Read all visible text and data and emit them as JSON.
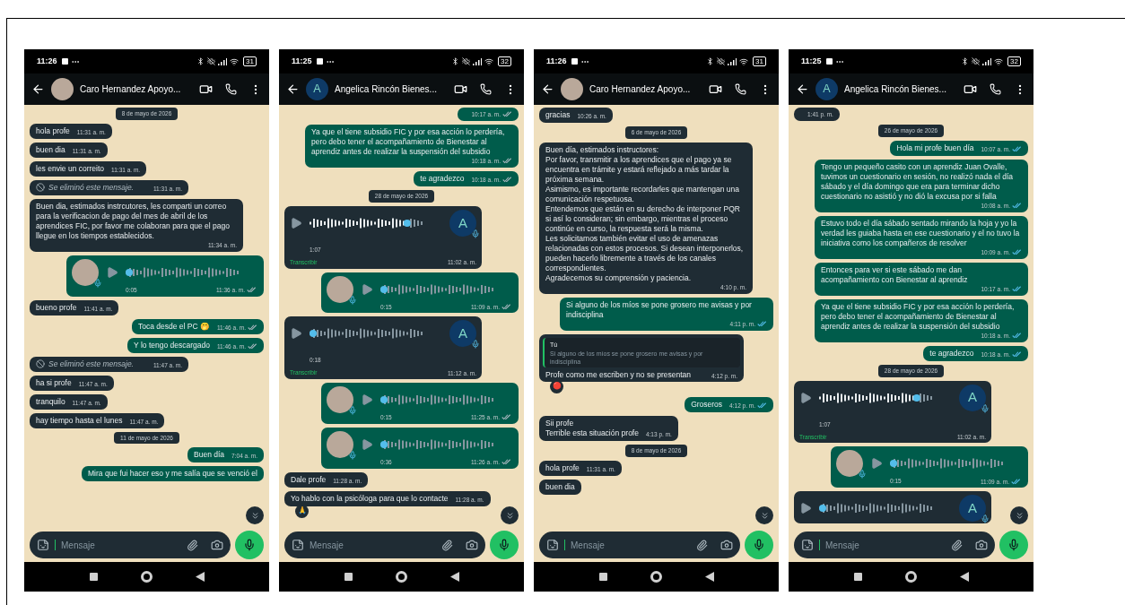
{
  "phones": [
    {
      "status": {
        "time": "11:26",
        "battery": "31"
      },
      "contact": {
        "name": "Caro Hernandez Apoyo...",
        "avatar": {
          "kind": "photo"
        }
      },
      "messages": [
        {
          "kind": "date",
          "text": "8 de mayo de 2026"
        },
        {
          "kind": "text",
          "outgoing": false,
          "text": "hola profe",
          "time": "11:31 a. m."
        },
        {
          "kind": "text",
          "outgoing": false,
          "text": "buen dia",
          "time": "11:31 a. m."
        },
        {
          "kind": "text",
          "outgoing": false,
          "text": "les envie un correito",
          "time": "11:31 a. m."
        },
        {
          "kind": "deleted",
          "outgoing": false,
          "text": "Se eliminó este mensaje.",
          "time": "11:31 a. m."
        },
        {
          "kind": "text",
          "outgoing": false,
          "text": "Buen dia, estimados instrcutores, les comparti un correo para la verificacion de pago del mes de abril de los aprendices FIC, por favor me colaboran para que el pago llegue en los tiempos establecidos.",
          "time": "11:34 a. m."
        },
        {
          "kind": "voice",
          "outgoing": true,
          "avatar": {
            "kind": "photo"
          },
          "duration": "0:05",
          "time": "11:36 a. m.",
          "level": 0,
          "read": false
        },
        {
          "kind": "text",
          "outgoing": false,
          "text": "bueno profe",
          "time": "11:41 a. m."
        },
        {
          "kind": "text",
          "outgoing": true,
          "text": "Toca desde el PC 🤭",
          "time": "11:46 a. m.",
          "read": false
        },
        {
          "kind": "text",
          "outgoing": true,
          "text": "Y lo tengo descargado",
          "time": "11:46 a. m.",
          "read": false
        },
        {
          "kind": "deleted",
          "outgoing": false,
          "text": "Se eliminó este mensaje.",
          "time": "11:47 a. m."
        },
        {
          "kind": "text",
          "outgoing": false,
          "text": "ha si profe",
          "time": "11:47 a. m."
        },
        {
          "kind": "text",
          "outgoing": false,
          "text": "tranquilo",
          "time": "11:47 a. m."
        },
        {
          "kind": "text",
          "outgoing": false,
          "text": "hay tiempo hasta el lunes",
          "time": "11:47 a. m."
        },
        {
          "kind": "date",
          "text": "11 de mayo de 2026"
        },
        {
          "kind": "text",
          "outgoing": true,
          "text": "Buen día",
          "time": "7:04 a. m."
        },
        {
          "kind": "text",
          "outgoing": true,
          "text": "Mira que fui hacer eso y me salía que se venció el"
        }
      ],
      "input": {
        "placeholder": "Mensaje",
        "focused": true
      }
    },
    {
      "status": {
        "time": "11:25",
        "battery": "32"
      },
      "contact": {
        "name": "Angelica Rincón Bienes...",
        "avatar": {
          "kind": "letter",
          "letter": "A"
        }
      },
      "messages": [
        {
          "kind": "text",
          "outgoing": true,
          "time": "10:17 a. m.",
          "read": false
        },
        {
          "kind": "text",
          "outgoing": true,
          "text": "Ya que el tiene subsidio FIC y por esa acción lo perdería, pero debo tener el acompañamiento de Bienestar al aprendiz antes de realizar la suspensión del subsidio",
          "time": "10:18 a. m.",
          "read": false
        },
        {
          "kind": "text",
          "outgoing": true,
          "text": "te agradezco",
          "time": "10:18 a. m.",
          "read": false
        },
        {
          "kind": "date",
          "text": "28 de mayo de 2026"
        },
        {
          "kind": "voice",
          "outgoing": false,
          "avatar": {
            "kind": "letter",
            "letter": "A"
          },
          "duration": "1:07",
          "time": "11:02 a. m.",
          "level": 0.85,
          "transcribe": "Transcribir"
        },
        {
          "kind": "voice",
          "outgoing": true,
          "avatar": {
            "kind": "photo"
          },
          "duration": "0:15",
          "time": "11:09 a. m.",
          "level": 0,
          "read": false
        },
        {
          "kind": "voice",
          "outgoing": false,
          "avatar": {
            "kind": "letter",
            "letter": "A"
          },
          "duration": "0:18",
          "time": "11:12 a. m.",
          "level": 0,
          "transcribe": "Transcribir"
        },
        {
          "kind": "voice",
          "outgoing": true,
          "avatar": {
            "kind": "photo"
          },
          "duration": "0:15",
          "time": "11:25 a. m.",
          "level": 0,
          "read": false
        },
        {
          "kind": "voice",
          "outgoing": true,
          "avatar": {
            "kind": "photo"
          },
          "duration": "0:36",
          "time": "11:26 a. m.",
          "level": 0,
          "read": false
        },
        {
          "kind": "text",
          "outgoing": false,
          "text": "Dale profe",
          "time": "11:28 a. m."
        },
        {
          "kind": "text",
          "outgoing": false,
          "text": "Yo hablo con la psicóloga para que lo contacte",
          "time": "11:28 a. m.",
          "reaction": "🙏"
        }
      ],
      "input": {
        "placeholder": "Mensaje",
        "focused": false
      }
    },
    {
      "status": {
        "time": "11:26",
        "battery": "31"
      },
      "contact": {
        "name": "Caro Hernandez Apoyo...",
        "avatar": {
          "kind": "photo"
        }
      },
      "messages": [
        {
          "kind": "text",
          "outgoing": false,
          "text": "gracias",
          "time": "10:26 a. m."
        },
        {
          "kind": "date",
          "text": "6 de mayo de 2026"
        },
        {
          "kind": "text",
          "outgoing": false,
          "text": "Buen día, estimados instructores:\nPor favor, transmitir a los aprendices que el pago ya se encuentra en trámite y estará reflejado a más tardar la próxima semana.\nAsimismo, es importante recordarles que mantengan una comunicación respetuosa.\nEntendemos que están en su derecho de interponer PQR si así lo consideran; sin embargo, mientras el proceso continúe en curso, la respuesta será la misma.\nLes solicitamos también evitar el uso de amenazas relacionadas con estos procesos. Si desean interponerlos, pueden hacerlo libremente a través de los canales correspondientes.\nAgradecemos su comprensión y paciencia.",
          "time": "4:10 p. m."
        },
        {
          "kind": "text",
          "outgoing": true,
          "text": "Si alguno de los míos se pone grosero me avisas y por indisciplina",
          "time": "4:11 p. m.",
          "read": true
        },
        {
          "kind": "reply",
          "outgoing": false,
          "quote_author": "Tú",
          "quote_text": "Si alguno de los míos se pone grosero me avisas y por indisciplina",
          "text": "Profe como me escriben y no se presentan",
          "time": "4:12 p. m.",
          "reaction": "🔴"
        },
        {
          "kind": "text",
          "outgoing": true,
          "text": "Groseros",
          "time": "4:12 p. m.",
          "read": true
        },
        {
          "kind": "text",
          "outgoing": false,
          "text": "Sii profe\nTerrible esta situación profe",
          "time": "4:13 p. m."
        },
        {
          "kind": "date",
          "text": "8 de mayo de 2026"
        },
        {
          "kind": "text",
          "outgoing": false,
          "text": "hola profe",
          "time": "11:31 a. m."
        },
        {
          "kind": "text",
          "outgoing": false,
          "text": "buen dia"
        }
      ],
      "input": {
        "placeholder": "Mensaje",
        "focused": true
      }
    },
    {
      "status": {
        "time": "11:25",
        "battery": "32"
      },
      "contact": {
        "name": "Angelica Rincón Bienes...",
        "avatar": {
          "kind": "letter",
          "letter": "A"
        }
      },
      "messages": [
        {
          "kind": "text",
          "outgoing": false,
          "time": "1:41 p. m."
        },
        {
          "kind": "date",
          "text": "26 de mayo de 2026"
        },
        {
          "kind": "text",
          "outgoing": true,
          "text": "Hola mi profe buen día",
          "time": "10:07 a. m.",
          "read": true
        },
        {
          "kind": "text",
          "outgoing": true,
          "text": "Tengo un pequeño casito con un aprendiz Juan Ovalle, tuvimos un cuestionario en sesión, no realizó nada el día sábado y el día domingo que era para terminar dicho cuestionario no asistió y no dió la excusa por si falla",
          "time": "10:08 a. m.",
          "read": true
        },
        {
          "kind": "text",
          "outgoing": true,
          "text": "Estuvo todo el día sábado sentado mirando la hoja y yo la verdad les guiaba hasta en ese cuestionario y el no tuvo la iniciativa como los compañeros de resolver",
          "time": "10:09 a. m.",
          "read": true
        },
        {
          "kind": "text",
          "outgoing": true,
          "text": "Entonces para ver si este sábado me dan acompañamiento con Bienestar al aprendiz",
          "time": "10:17 a. m.",
          "read": true
        },
        {
          "kind": "text",
          "outgoing": true,
          "text": "Ya que el tiene subsidio FIC y por esa acción lo perdería, pero debo tener el acompañamiento de Bienestar al aprendiz antes de realizar la suspensión del subsidio",
          "time": "10:18 a. m.",
          "read": true
        },
        {
          "kind": "text",
          "outgoing": true,
          "text": "te agradezco",
          "time": "10:18 a. m.",
          "read": true
        },
        {
          "kind": "date",
          "text": "28 de mayo de 2026"
        },
        {
          "kind": "voice",
          "outgoing": false,
          "avatar": {
            "kind": "letter",
            "letter": "A"
          },
          "duration": "1:07",
          "time": "11:02 a. m.",
          "level": 0.85,
          "transcribe": "Transcribir"
        },
        {
          "kind": "voice",
          "outgoing": true,
          "avatar": {
            "kind": "photo"
          },
          "duration": "0:15",
          "time": "11:09 a. m.",
          "level": 0,
          "read": true
        },
        {
          "kind": "voice",
          "outgoing": false,
          "avatar": {
            "kind": "letter",
            "letter": "A"
          },
          "level": 0
        }
      ],
      "input": {
        "placeholder": "Mensaje",
        "focused": true
      }
    }
  ]
}
